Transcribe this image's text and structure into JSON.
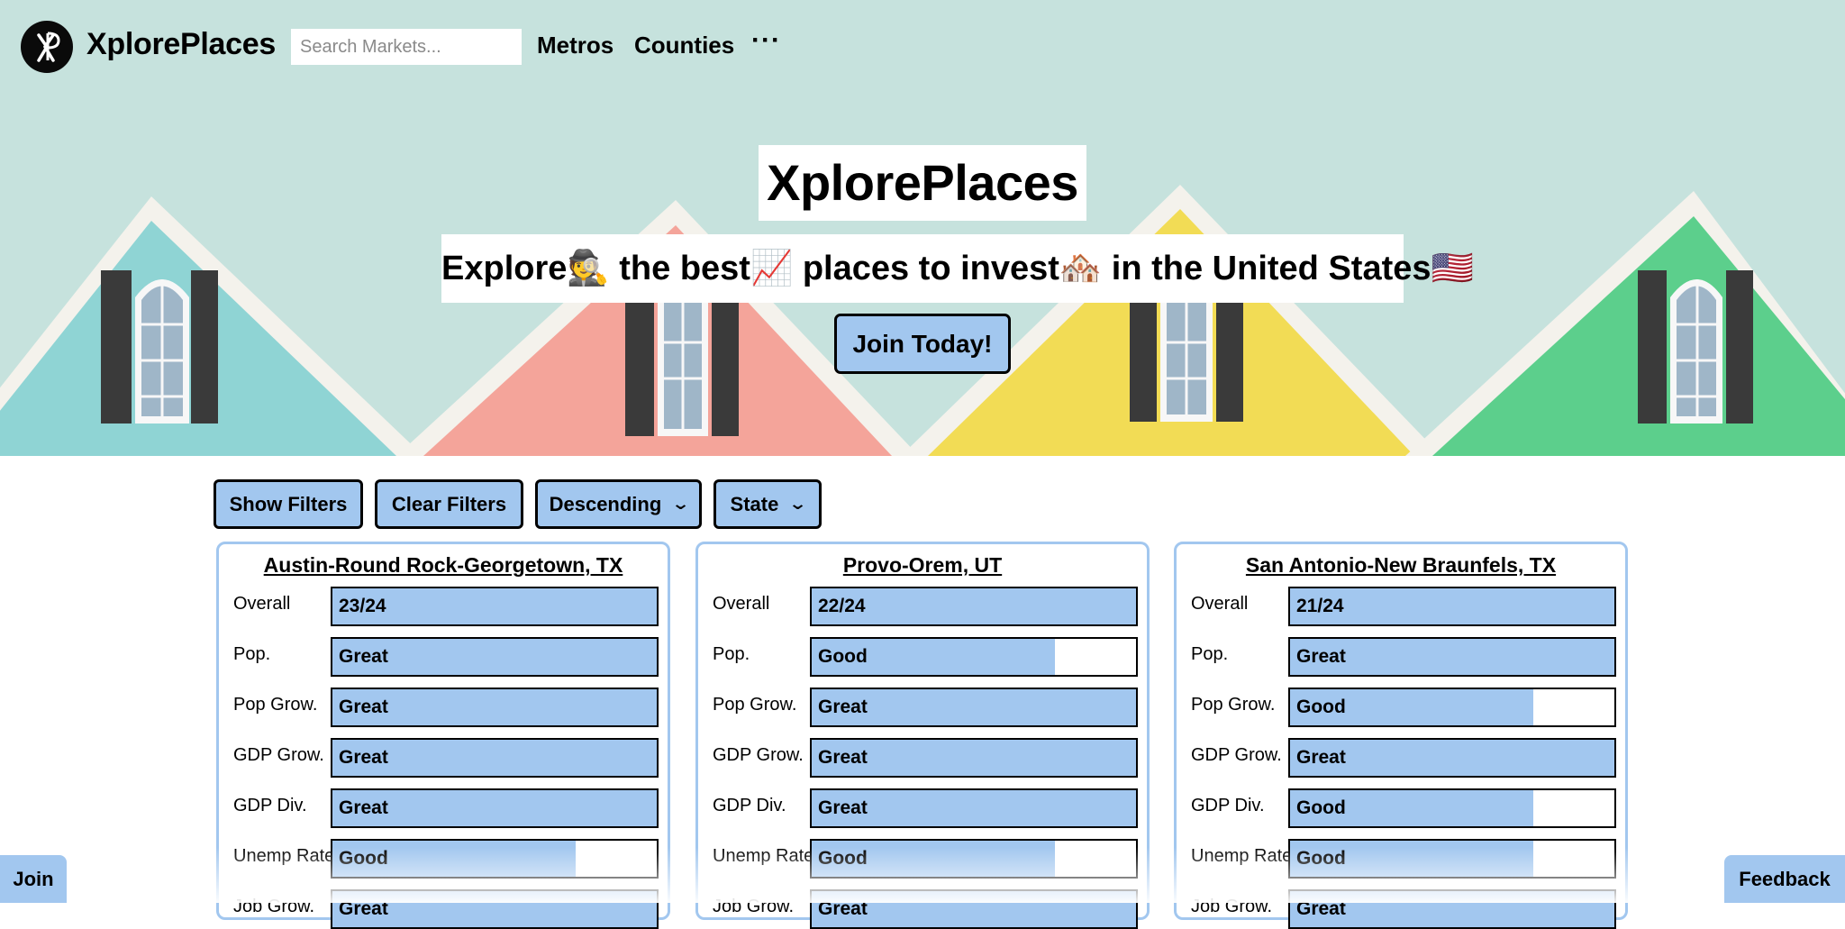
{
  "nav": {
    "brand": "XplorePlaces",
    "search_placeholder": "Search Markets...",
    "links": [
      "Metros",
      "Counties"
    ],
    "more": "···"
  },
  "hero": {
    "title": "XplorePlaces",
    "subtitle": "Explore🕵️ the best📈 places to invest🏘️ in the United States🇺🇸",
    "cta": "Join Today!"
  },
  "controls": {
    "show_filters": "Show Filters",
    "clear_filters": "Clear Filters",
    "sort_order": "Descending",
    "group_by": "State"
  },
  "metrics": [
    "Overall",
    "Pop.",
    "Pop Grow.",
    "GDP Grow.",
    "GDP Div.",
    "Unemp Rate",
    "Job Grow."
  ],
  "cards": [
    {
      "title": "Austin-Round Rock-Georgetown, TX",
      "values": [
        "23/24",
        "Great",
        "Great",
        "Great",
        "Great",
        "Good",
        "Great"
      ],
      "levels": [
        1,
        1,
        1,
        1,
        1,
        0.75,
        1
      ]
    },
    {
      "title": "Provo-Orem, UT",
      "values": [
        "22/24",
        "Good",
        "Great",
        "Great",
        "Great",
        "Good",
        "Great"
      ],
      "levels": [
        1,
        0.75,
        1,
        1,
        1,
        0.75,
        1
      ]
    },
    {
      "title": "San Antonio-New Braunfels, TX",
      "values": [
        "21/24",
        "Great",
        "Good",
        "Great",
        "Good",
        "Good",
        "Great"
      ],
      "levels": [
        1,
        1,
        0.75,
        1,
        0.75,
        0.75,
        1
      ]
    }
  ],
  "floating": {
    "join": "Join",
    "feedback": "Feedback"
  },
  "colors": {
    "accent": "#a2c7ef",
    "sky": "#c6e2dd",
    "house_teal": "#8fd4d4",
    "house_pink": "#f4a49a",
    "house_yellow": "#f2dc55",
    "house_green": "#5ccf8c"
  }
}
